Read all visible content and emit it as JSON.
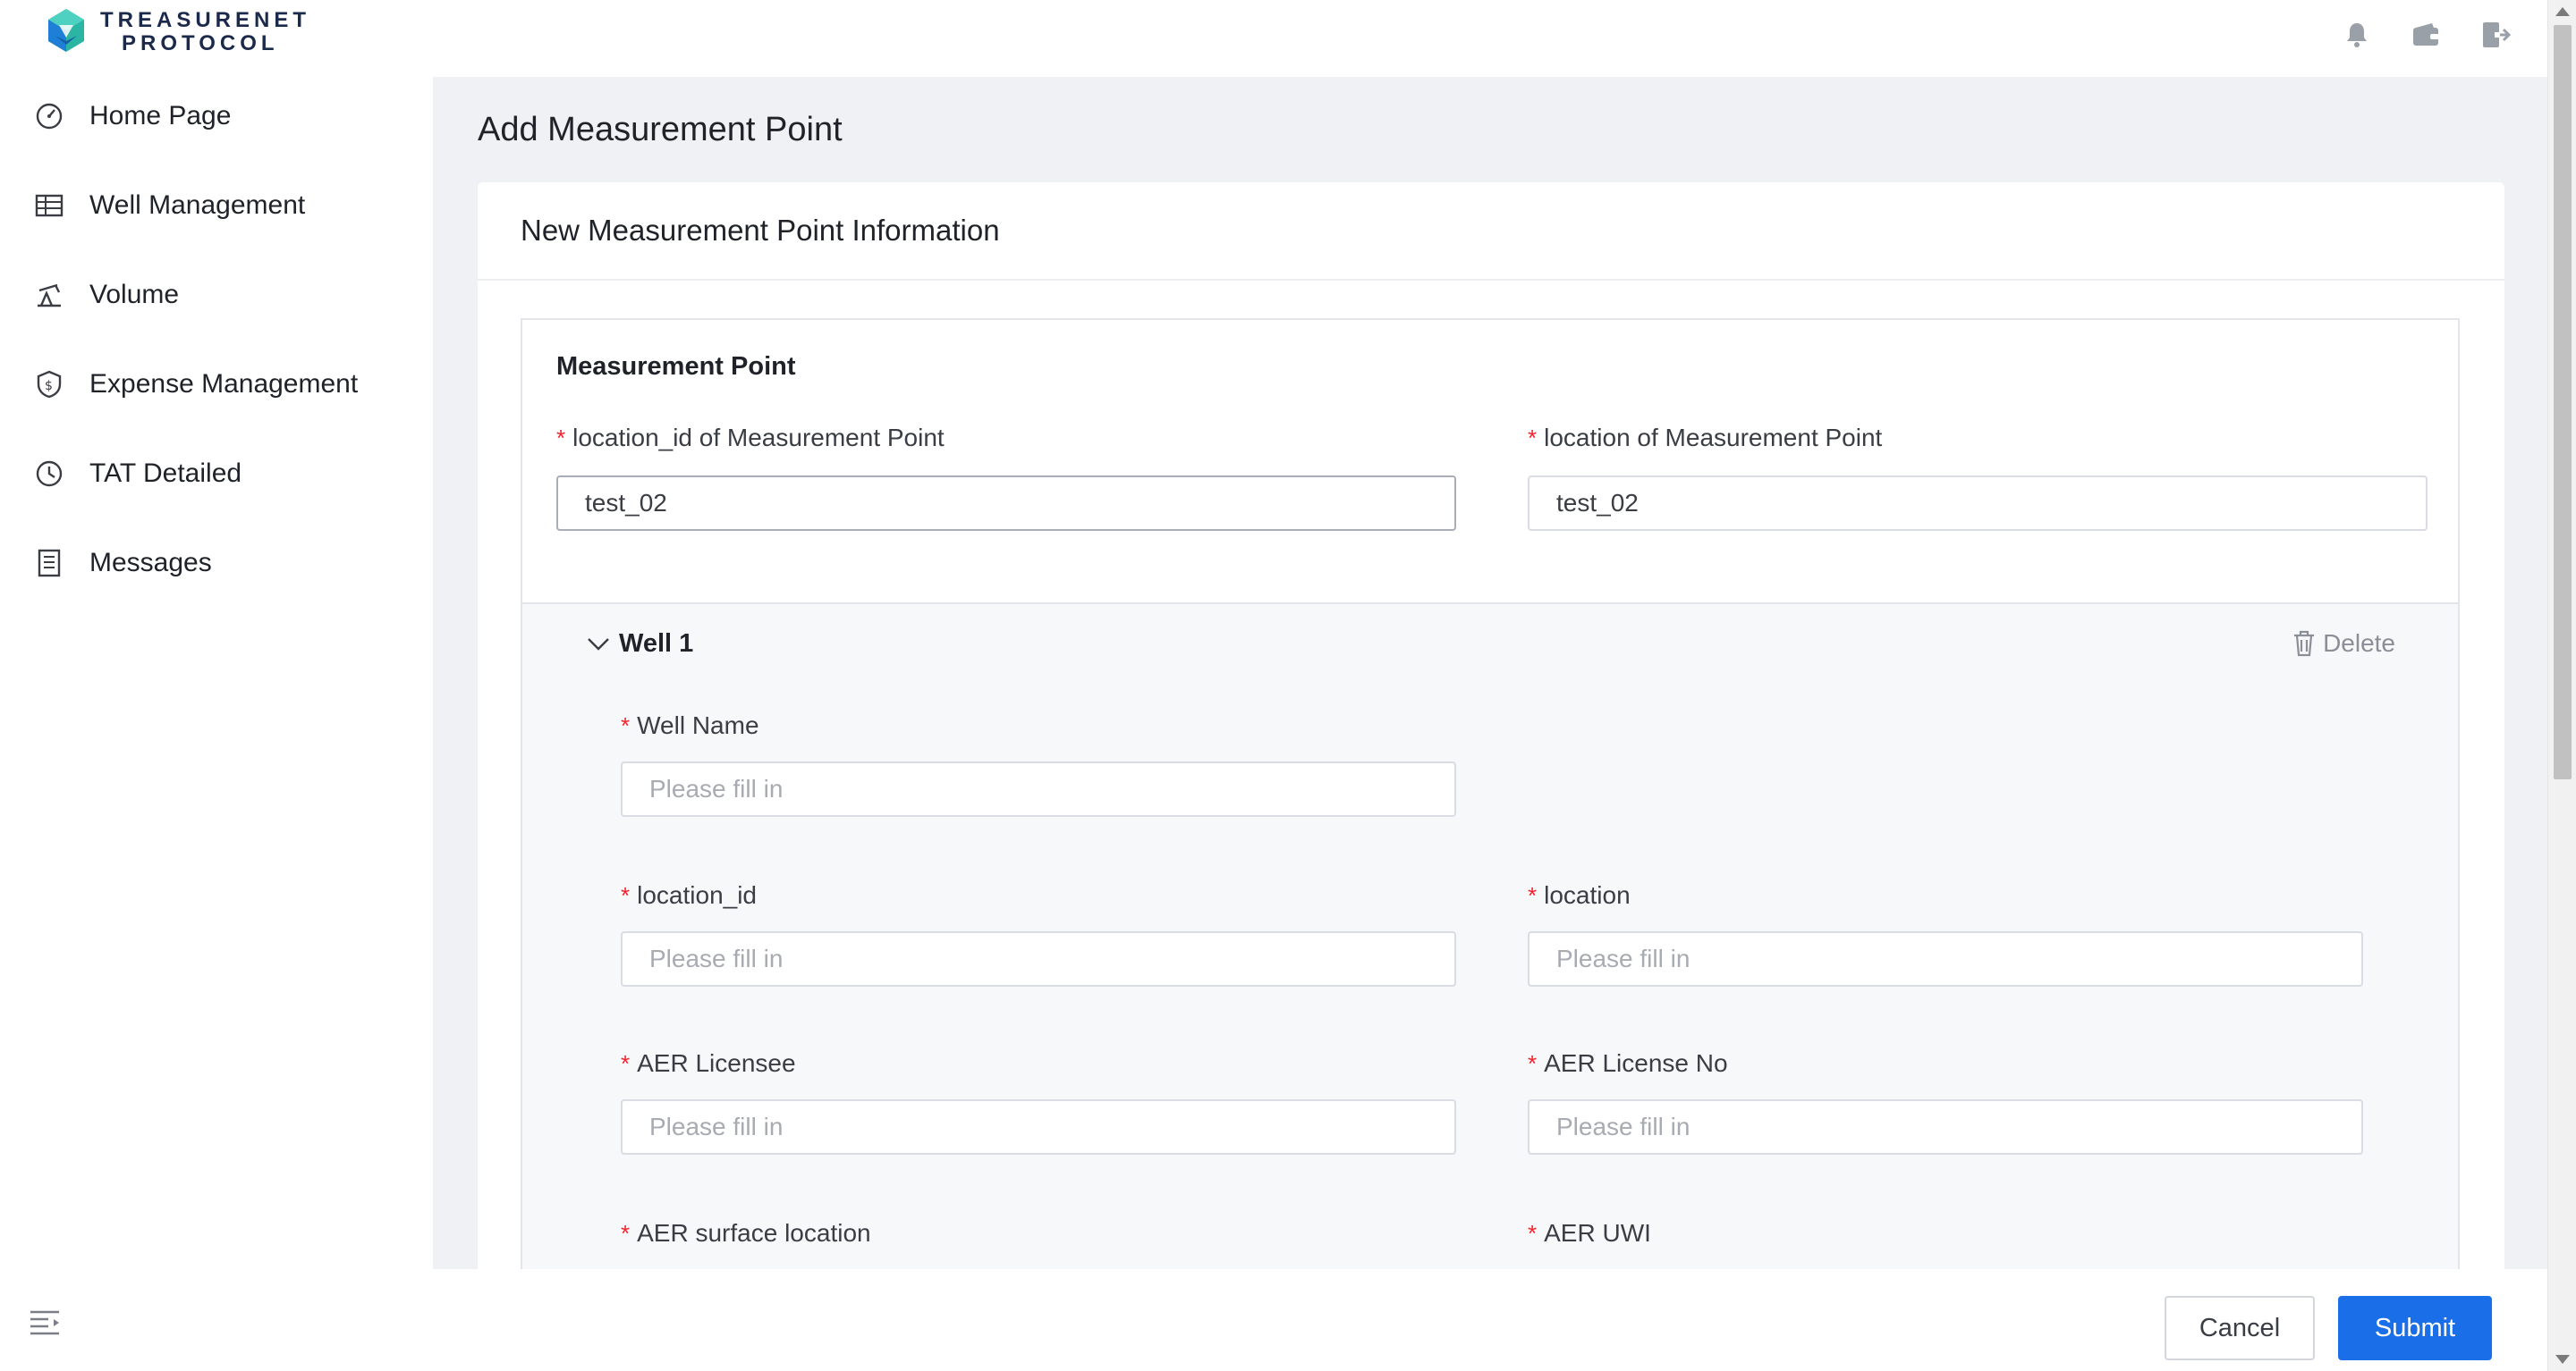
{
  "brand": {
    "line1": "TREASURENET",
    "line2": "PROTOCOL"
  },
  "header": {
    "icons": [
      "bell-icon",
      "wallet-icon",
      "logout-icon"
    ]
  },
  "sidebar": {
    "items": [
      {
        "label": "Home Page",
        "icon": "dashboard-icon"
      },
      {
        "label": "Well Management",
        "icon": "table-icon"
      },
      {
        "label": "Volume",
        "icon": "pumpjack-icon"
      },
      {
        "label": "Expense Management",
        "icon": "shield-dollar-icon"
      },
      {
        "label": "TAT Detailed",
        "icon": "clock-icon"
      },
      {
        "label": "Messages",
        "icon": "list-doc-icon"
      }
    ]
  },
  "page": {
    "title": "Add Measurement Point"
  },
  "card": {
    "title": "New Measurement Point Information"
  },
  "measurement_point": {
    "title": "Measurement Point",
    "location_id_label": "location_id of Measurement Point",
    "location_id_value": "test_02",
    "location_label": "location of Measurement Point",
    "location_value": "test_02"
  },
  "well": {
    "title": "Well 1",
    "delete_label": "Delete",
    "placeholder": "Please fill in",
    "well_name_label": "Well Name",
    "location_id_label": "location_id",
    "location_label": "location",
    "aer_licensee_label": "AER Licensee",
    "aer_license_no_label": "AER License No",
    "aer_surface_location_label": "AER surface location",
    "aer_uwi_label": "AER UWI"
  },
  "footer": {
    "cancel_label": "Cancel",
    "submit_label": "Submit"
  },
  "colors": {
    "primary": "#1a6ee8",
    "required": "#f5222d",
    "brand": "#1b2a4a"
  }
}
